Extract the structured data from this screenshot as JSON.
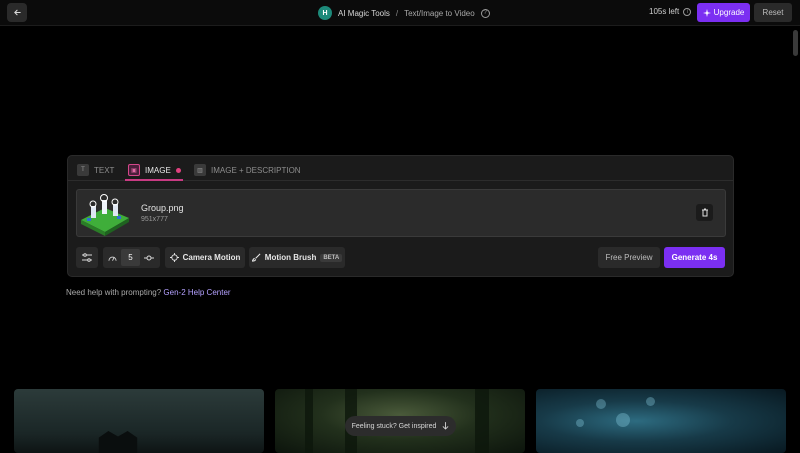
{
  "header": {
    "avatar_letter": "H",
    "breadcrumb_root": "AI Magic Tools",
    "breadcrumb_sep": "/",
    "breadcrumb_current": "Text/Image to Video",
    "time_left": "105s left",
    "upgrade_label": "Upgrade",
    "reset_label": "Reset"
  },
  "tabs": [
    {
      "label": "TEXT",
      "active": false
    },
    {
      "label": "IMAGE",
      "active": true
    },
    {
      "label": "IMAGE + DESCRIPTION",
      "active": false
    }
  ],
  "file": {
    "name": "Group.png",
    "dimensions": "951x777"
  },
  "toolbar": {
    "speed_value": "5",
    "camera_motion_label": "Camera Motion",
    "motion_brush_label": "Motion Brush",
    "beta_label": "BETA",
    "free_preview_label": "Free Preview",
    "generate_label": "Generate 4s"
  },
  "help": {
    "prompt_text": "Need help with prompting?",
    "link_text": "Gen-2 Help Center"
  },
  "inspire": {
    "label": "Feeling stuck? Get inspired"
  },
  "colors": {
    "accent": "#7b2ff2",
    "active_tab": "#c93b83",
    "background": "#000000"
  }
}
